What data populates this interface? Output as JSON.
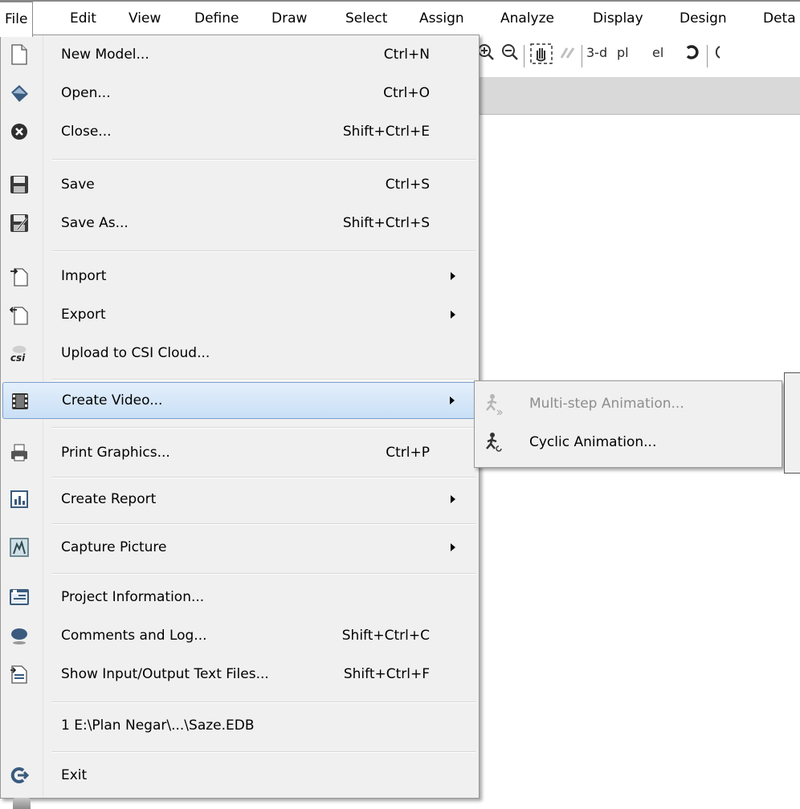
{
  "menubar": {
    "items": [
      "File",
      "Edit",
      "View",
      "Define",
      "Draw",
      "Select",
      "Assign",
      "Analyze",
      "Display",
      "Design",
      "Deta"
    ]
  },
  "toolbar": {
    "view_3d_label": "3-d",
    "plan_label": "pl",
    "elev_label": "el"
  },
  "file_menu": {
    "items": [
      {
        "label": "New Model...",
        "shortcut": "Ctrl+N",
        "icon": "new-document-icon"
      },
      {
        "label": "Open...",
        "shortcut": "Ctrl+O",
        "icon": "open-folder-icon"
      },
      {
        "label": "Close...",
        "shortcut": "Shift+Ctrl+E",
        "icon": "close-circle-icon"
      },
      {
        "label": "Save",
        "shortcut": "Ctrl+S",
        "icon": "save-disk-icon"
      },
      {
        "label": "Save As...",
        "shortcut": "Shift+Ctrl+S",
        "icon": "save-as-icon"
      },
      {
        "label": "Import",
        "shortcut": "",
        "icon": "import-icon"
      },
      {
        "label": "Export",
        "shortcut": "",
        "icon": "export-icon"
      },
      {
        "label": "Upload to CSI Cloud...",
        "shortcut": "",
        "icon": "csi-cloud-icon"
      },
      {
        "label": "Create Video...",
        "shortcut": "",
        "icon": "film-icon"
      },
      {
        "label": "Print Graphics...",
        "shortcut": "Ctrl+P",
        "icon": "printer-icon"
      },
      {
        "label": "Create Report",
        "shortcut": "",
        "icon": "report-chart-icon"
      },
      {
        "label": "Capture Picture",
        "shortcut": "",
        "icon": "capture-picture-icon"
      },
      {
        "label": "Project Information...",
        "shortcut": "",
        "icon": "project-info-icon"
      },
      {
        "label": "Comments and Log...",
        "shortcut": "Shift+Ctrl+C",
        "icon": "speech-bubble-icon"
      },
      {
        "label": "Show Input/Output Text Files...",
        "shortcut": "Shift+Ctrl+F",
        "icon": "text-files-icon"
      },
      {
        "label": "1 E:\\Plan Negar\\...\\Saze.EDB",
        "shortcut": "",
        "icon": ""
      },
      {
        "label": "Exit",
        "shortcut": "",
        "icon": "exit-arrow-icon"
      }
    ]
  },
  "submenu": {
    "items": [
      {
        "label": "Multi-step Animation...",
        "enabled": false,
        "icon": "multistep-animation-icon"
      },
      {
        "label": "Cyclic Animation...",
        "enabled": true,
        "icon": "cyclic-animation-icon"
      }
    ]
  },
  "colors": {
    "highlight_border": "#7ba1cf",
    "highlight_fill": "#c9dff6",
    "menu_bg": "#f0f0f0",
    "disabled_text": "#8d8d8d"
  }
}
